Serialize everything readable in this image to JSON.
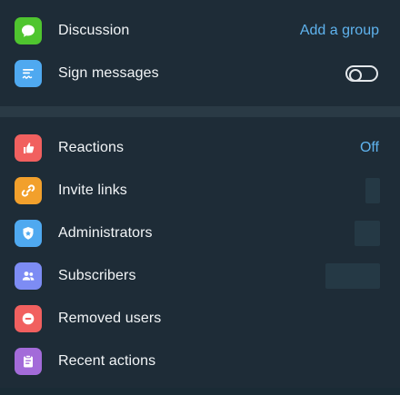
{
  "settings_top": {
    "discussion": {
      "label": "Discussion",
      "value": "Add a group",
      "icon": "chat-bubble-icon",
      "icon_color": "#4fc52f"
    },
    "sign_messages": {
      "label": "Sign messages",
      "icon": "signature-icon",
      "icon_color": "#4fa9f0",
      "toggle_on": false
    }
  },
  "settings_bottom": {
    "reactions": {
      "label": "Reactions",
      "value": "Off",
      "icon": "thumbs-up-icon",
      "icon_color": "#f1605f"
    },
    "invite_links": {
      "label": "Invite links",
      "icon": "link-icon",
      "icon_color": "#f2a02c"
    },
    "administrators": {
      "label": "Administrators",
      "icon": "shield-star-icon",
      "icon_color": "#4fa9f0"
    },
    "subscribers": {
      "label": "Subscribers",
      "icon": "people-icon",
      "icon_color": "#7d8cf4"
    },
    "removed_users": {
      "label": "Removed users",
      "icon": "minus-circle-icon",
      "icon_color": "#f1605f"
    },
    "recent_actions": {
      "label": "Recent actions",
      "icon": "clipboard-icon",
      "icon_color": "#a36bd9"
    }
  },
  "colors": {
    "background": "#1e2c37",
    "divider": "#2a3a45",
    "text": "#f2f5f7",
    "accent": "#5fb3ee"
  }
}
